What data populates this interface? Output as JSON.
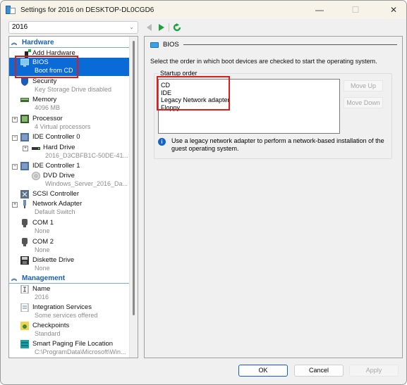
{
  "window": {
    "title": "Settings for 2016 on DESKTOP-DL0CGD6",
    "minimize_icon": "minimize-icon",
    "maximize_icon": "maximize-icon",
    "close_icon": "close-icon",
    "minimize_glyph": "—",
    "maximize_glyph": "☐",
    "close_glyph": "✕"
  },
  "toolbar": {
    "vm_selected": "2016",
    "back_icon": "triangle-left-icon",
    "forward_icon": "play-icon",
    "refresh_icon": "refresh-icon"
  },
  "tree": {
    "hardware_label": "Hardware",
    "management_label": "Management",
    "hardware": [
      {
        "id": "add-hardware",
        "label": "Add Hardware",
        "sub": "",
        "icon": "add-hardware-icon"
      },
      {
        "id": "bios",
        "label": "BIOS",
        "sub": "Boot from CD",
        "icon": "monitor-icon",
        "selected": true
      },
      {
        "id": "security",
        "label": "Security",
        "sub": "Key Storage Drive disabled",
        "icon": "shield-icon"
      },
      {
        "id": "memory",
        "label": "Memory",
        "sub": "4096 MB",
        "icon": "memory-icon"
      },
      {
        "id": "processor",
        "label": "Processor",
        "sub": "4 Virtual processors",
        "icon": "processor-icon",
        "expander": "+"
      },
      {
        "id": "ide-controller-0",
        "label": "IDE Controller 0",
        "sub": "",
        "icon": "controller-icon",
        "expander": "−"
      },
      {
        "id": "hard-drive",
        "label": "Hard Drive",
        "sub": "2016_D3CBFB1C-50DE-41...",
        "icon": "hard-drive-icon",
        "expander": "+",
        "indent": 1
      },
      {
        "id": "ide-controller-1",
        "label": "IDE Controller 1",
        "sub": "",
        "icon": "controller-icon",
        "expander": "−"
      },
      {
        "id": "dvd-drive",
        "label": "DVD Drive",
        "sub": "Windows_Server_2016_Da...",
        "icon": "dvd-icon",
        "indent": 1
      },
      {
        "id": "scsi-controller",
        "label": "SCSI Controller",
        "sub": "",
        "icon": "scsi-icon"
      },
      {
        "id": "network-adapter",
        "label": "Network Adapter",
        "sub": "Default Switch",
        "icon": "network-adapter-icon",
        "expander": "+"
      },
      {
        "id": "com1",
        "label": "COM 1",
        "sub": "None",
        "icon": "com-port-icon"
      },
      {
        "id": "com2",
        "label": "COM 2",
        "sub": "None",
        "icon": "com-port-icon"
      },
      {
        "id": "diskette-drive",
        "label": "Diskette Drive",
        "sub": "None",
        "icon": "floppy-icon"
      }
    ],
    "management": [
      {
        "id": "name",
        "label": "Name",
        "sub": "2016",
        "icon": "name-icon"
      },
      {
        "id": "integration-services",
        "label": "Integration Services",
        "sub": "Some services offered",
        "icon": "integration-icon"
      },
      {
        "id": "checkpoints",
        "label": "Checkpoints",
        "sub": "Standard",
        "icon": "checkpoint-icon"
      },
      {
        "id": "smart-paging",
        "label": "Smart Paging File Location",
        "sub": "C:\\ProgramData\\Microsoft\\Win...",
        "icon": "paging-icon"
      }
    ]
  },
  "bios_panel": {
    "header": "BIOS",
    "description": "Select the order in which boot devices are checked to start the operating system.",
    "startup_order_label": "Startup order",
    "startup_order": [
      "CD",
      "IDE",
      "Legacy Network adapter",
      "Floppy"
    ],
    "move_up": "Move Up",
    "move_down": "Move Down",
    "info_text": "Use a legacy network adapter to perform a network-based installation of the guest operating system."
  },
  "buttons": {
    "ok": "OK",
    "cancel": "Cancel",
    "apply": "Apply"
  },
  "colors": {
    "selection": "#0a6ad6",
    "highlight_box": "#e01b1b",
    "section_heading": "#1b5fb0"
  }
}
